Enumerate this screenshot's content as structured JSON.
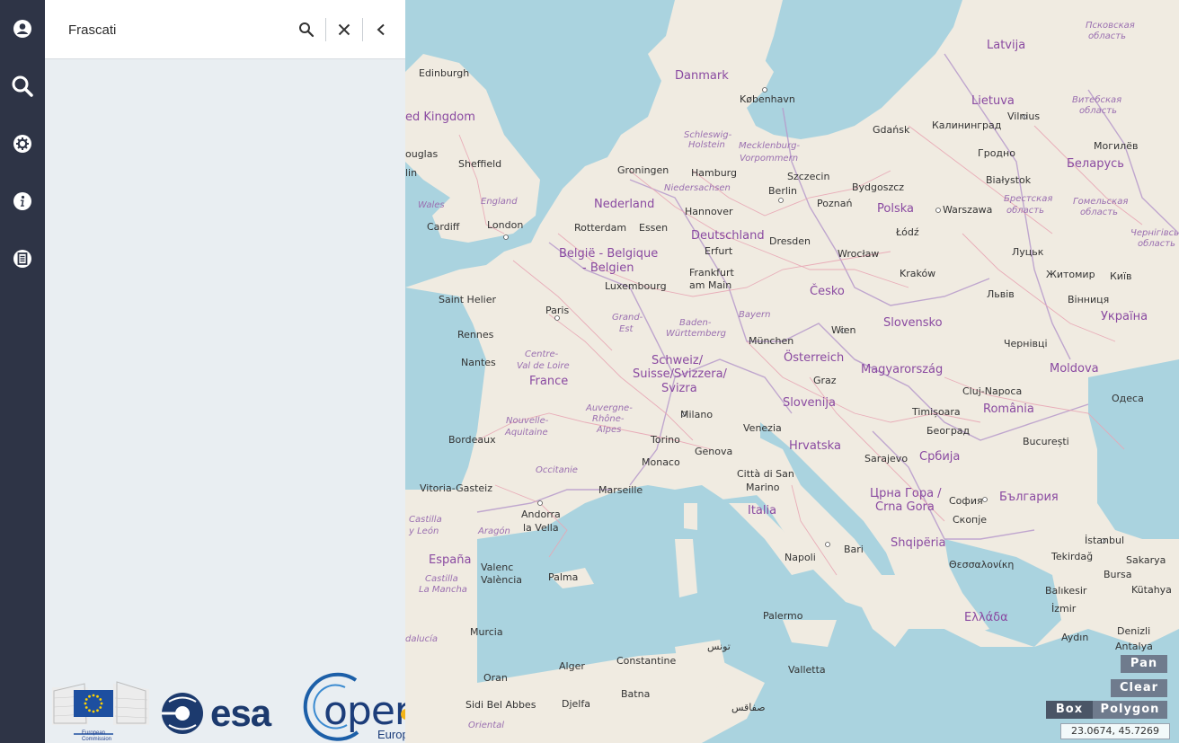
{
  "search": {
    "value": "Frascati"
  },
  "rail": {
    "items": [
      {
        "icon": "user-icon"
      },
      {
        "icon": "search-icon"
      },
      {
        "icon": "settings-icon"
      },
      {
        "icon": "info-icon"
      },
      {
        "icon": "documents-icon"
      }
    ]
  },
  "logos": {
    "ec_label": "European Commission",
    "esa": "esa",
    "copernicus": "opernicus",
    "copernicus_tagline": "Europe's eyes on Earth"
  },
  "map": {
    "controls": {
      "pan": "Pan",
      "clear": "Clear",
      "box": "Box",
      "polygon": "Polygon"
    },
    "coordinates": "23.0674, 45.7269",
    "countries": {
      "danmark": "Danmark",
      "latvija": "Latvija",
      "lietuva": "Lietuva",
      "united_kingdom": "ed Kingdom",
      "belarus": "Беларусь",
      "nederland": "Nederland",
      "deutschland": "Deutschland",
      "polska": "Polska",
      "belgie": "België - Belgique",
      "belgien": "- Belgien",
      "cesko": "Česko",
      "ukraina": "Україна",
      "slovensko": "Slovensko",
      "france": "France",
      "schweiz1": "Schweiz/",
      "schweiz2": "Suisse/Svizzera/",
      "schweiz3": "Svizra",
      "osterreich": "Österreich",
      "magyarorszag": "Magyarország",
      "moldova": "Moldova",
      "slovenija": "Slovenija",
      "romania": "România",
      "hrvatska": "Hrvatska",
      "srbija": "Србија",
      "cg1": "Црна Гора /",
      "cg2": "Crna Gora",
      "balgaria": "България",
      "italia": "Italia",
      "shqiperia": "Shqipëria",
      "espana": "España",
      "ellada": "Ελλάδα"
    },
    "cities": {
      "edinburgh": "Edinburgh",
      "kobenhavn": "København",
      "vilnius": "Vilnius",
      "douglas": "ouglas",
      "sheffield": "Sheffield",
      "lin": "lin",
      "gdansk": "Gdańsk",
      "kaliningrad": "Калининград",
      "mogilev": "Могилёв",
      "groningen": "Groningen",
      "hamburg": "Hamburg",
      "szczecin": "Szczecin",
      "grodno": "Гродно",
      "bialystok": "Białystok",
      "bydgoszcz": "Bydgoszcz",
      "london": "London",
      "cardiff": "Cardiff",
      "berlin": "Berlin",
      "poznan": "Poznań",
      "rotterdam": "Rotterdam",
      "essen": "Essen",
      "hannover": "Hannover",
      "warszawa": "Warszawa",
      "erfurt": "Erfurt",
      "dresden": "Dresden",
      "lodz": "Łódź",
      "wroclaw": "Wrocław",
      "lutsk": "Луцьк",
      "frankfurt1": "Frankfurt",
      "frankfurt2": "am Main",
      "luxembourg": "Luxembourg",
      "krakow": "Kraków",
      "zhytomyr": "Житомир",
      "kyiv": "Київ",
      "saint_helier": "Saint Helier",
      "paris": "Paris",
      "lviv": "Львів",
      "vinnytsia": "Вінниця",
      "rennes": "Rennes",
      "munchen": "München",
      "wien": "Wien",
      "chernivtsi": "Чернівці",
      "nantes": "Nantes",
      "graz": "Graz",
      "cluj": "Cluj-Napoca",
      "odesa": "Одеса",
      "milano": "Milano",
      "venezia": "Venezia",
      "timisoara": "Timișoara",
      "bordeaux": "Bordeaux",
      "torino": "Torino",
      "beograd": "Београд",
      "bucuresti": "București",
      "monaco": "Monaco",
      "genova": "Genova",
      "sarajevo": "Sarajevo",
      "vitoria": "Vitoria-Gasteiz",
      "citta": "Città di San",
      "marino": "Marino",
      "marseille": "Marseille",
      "sofia": "София",
      "skopje": "Скопје",
      "andorra1": "Andorra",
      "andorra2": "la Vella",
      "istanbul": "İstanbul",
      "tekirdag": "Tekirdağ",
      "sakarya": "Sakarya",
      "bari": "Bari",
      "thessaloniki": "Θεσσαλονίκη",
      "valenc1": "Valenc",
      "valenc2": "València",
      "palma": "Palma",
      "napoli": "Napoli",
      "bursa": "Bursa",
      "balikesir": "Balıkesir",
      "kutahya": "Kütahya",
      "palermo": "Palermo",
      "izmir": "İzmir",
      "denizli": "Denizli",
      "aydin": "Aydın",
      "murcia": "Murcia",
      "antalya": "Antalya",
      "tunis": "تونس",
      "valletta": "Valletta",
      "alger": "Alger",
      "constantine": "Constantine",
      "oran": "Oran",
      "batna": "Batna",
      "sidi": "Sidi Bel Abbes",
      "djelfa": "Djelfa",
      "safaqis": "صفاقس"
    },
    "regions": {
      "schleswig": "Schleswig-",
      "holstein": "Holstein",
      "meck1": "Mecklenburg-",
      "meck2": "Vorpommern",
      "nieder": "Niedersachsen",
      "wales": "Wales",
      "england": "England",
      "bayern": "Bayern",
      "grand1": "Grand-",
      "grand2": "Est",
      "baden1": "Baden-",
      "baden2": "Württemberg",
      "centre1": "Centre-",
      "centre2": "Val de Loire",
      "nouvelle1": "Nouvelle-",
      "nouvelle2": "Aquitaine",
      "auvergne1": "Auvergne-",
      "auvergne2": "Rhône-",
      "auvergne3": "Alpes",
      "occitanie": "Occitanie",
      "castilla": "Castilla",
      "leon": "y León",
      "aragon": "Aragón",
      "castilla2": "Castilla",
      "mancha": "La Mancha",
      "dalucia": "dalucía",
      "brest1": "Брестская",
      "brest2": "область",
      "gomel1": "Гомельская",
      "gomel2": "область",
      "vitebsk1": "Витебская",
      "vitebsk2": "область",
      "pskov1": "Псковская",
      "pskov2": "область",
      "chern1": "Чернігівсь",
      "chern2": "область",
      "orient": "Oriental"
    }
  }
}
